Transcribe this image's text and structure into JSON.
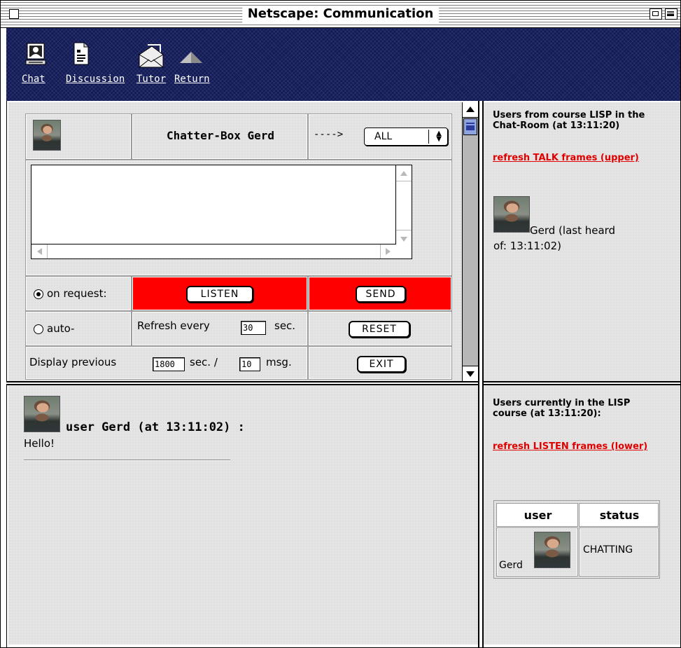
{
  "window": {
    "title": "Netscape: Communication"
  },
  "nav": {
    "items": [
      {
        "label": "Chat",
        "icon": "chat-icon"
      },
      {
        "label": "Discussion",
        "icon": "document-icon"
      },
      {
        "label": "Tutor",
        "icon": "envelope-icon"
      },
      {
        "label": "Return",
        "icon": "up-arrow-icon"
      }
    ]
  },
  "chat_form": {
    "title": "Chatter-Box Gerd",
    "arrow": "---->",
    "recipient_select": "ALL",
    "message_value": "",
    "on_request_label": "on request:",
    "auto_label": "auto-",
    "listen_button": "LISTEN",
    "send_button": "SEND",
    "reset_button": "RESET",
    "exit_button": "EXIT",
    "refresh_prefix": "Refresh every",
    "refresh_value": "30",
    "refresh_suffix": "sec.",
    "display_prefix": "Display previous",
    "display_seconds_value": "1800",
    "display_mid": "sec. /",
    "display_msg_value": "10",
    "display_suffix": "msg.",
    "mode_selected": "on request"
  },
  "talk_users": {
    "header": "Users from course LISP in the Chat-Room (at 13:11:20)",
    "refresh_link": "refresh TALK frames (upper)",
    "user_line1": "Gerd (last heard",
    "user_line2": "of: 13:11:02)"
  },
  "messages": [
    {
      "header": "user Gerd (at 13:11:02) :",
      "text": "Hello!"
    }
  ],
  "course_users": {
    "header": "Users currently in the LISP course (at 13:11:20):",
    "refresh_link": "refresh LISTEN frames (lower)",
    "columns": [
      "user",
      "status"
    ],
    "rows": [
      {
        "user": "Gerd",
        "status": "CHATTING"
      }
    ]
  },
  "colors": {
    "navbar": "#141c58",
    "button_cell_red": "#ff0000",
    "link_red": "#e00000",
    "frame_gray": "#e4e4e4"
  }
}
